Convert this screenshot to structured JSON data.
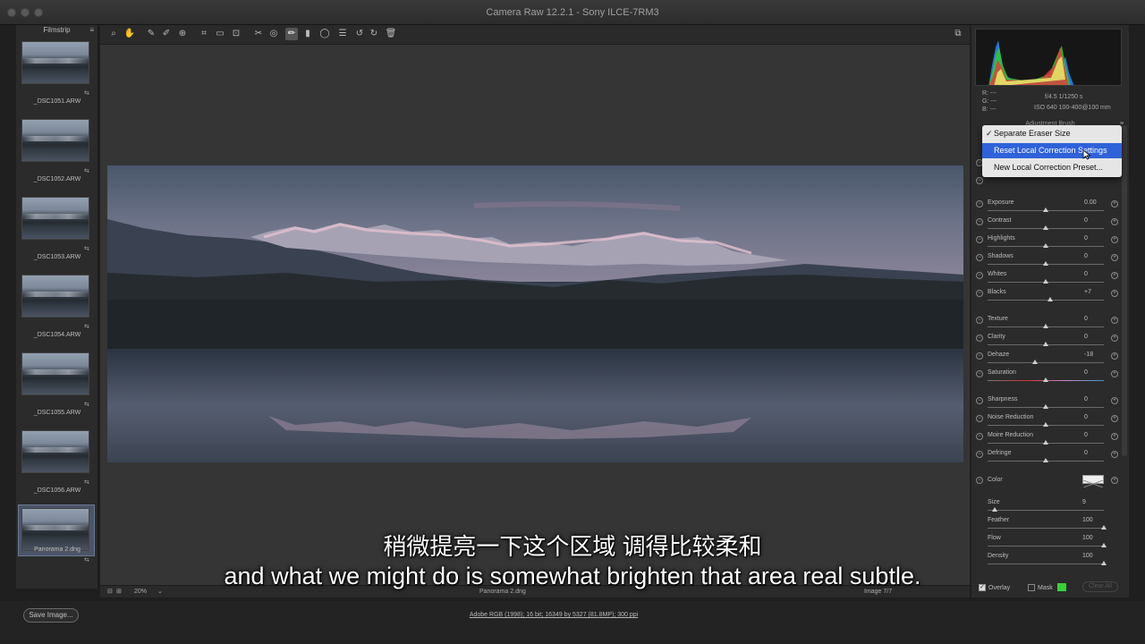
{
  "window": {
    "title": "Camera Raw 12.2.1  -  Sony ILCE-7RM3"
  },
  "filmstrip": {
    "header": "Filmstrip",
    "items": [
      {
        "label": "_DSC1051.ARW"
      },
      {
        "label": "_DSC1052.ARW"
      },
      {
        "label": "_DSC1053.ARW"
      },
      {
        "label": "_DSC1054.ARW"
      },
      {
        "label": "_DSC1055.ARW"
      },
      {
        "label": "_DSC1056.ARW"
      },
      {
        "label": "Panorama 2.dng",
        "selected": true
      }
    ]
  },
  "toolbar": {
    "icons": [
      "zoom-icon",
      "hand-icon",
      "white-balance-icon",
      "color-sampler-icon",
      "targeted-adjustment-icon",
      "crop-icon",
      "straighten-icon",
      "transform-icon",
      "spot-removal-icon",
      "red-eye-icon",
      "adjustment-brush-icon",
      "graduated-filter-icon",
      "radial-filter-icon",
      "preferences-icon",
      "rotate-left-icon",
      "rotate-right-icon",
      "trash-icon"
    ],
    "active": "adjustment-brush-icon"
  },
  "canvas": {
    "zoom": "20%",
    "filename": "Panorama 2.dng",
    "image_count": "Image 7/7"
  },
  "info": {
    "r": "R:  ---",
    "g": "G:  ---",
    "b": "B:  ---",
    "aperture_shutter": "f/4.5   1/1250 s",
    "iso_lens": "ISO 640   100-400@100 mm"
  },
  "panel": {
    "title": "Adjustment Brush"
  },
  "menu": {
    "items": [
      {
        "label": "Separate Eraser Size",
        "checked": true
      },
      {
        "label": "Reset Local Correction Settings",
        "highlighted": true
      },
      {
        "label": "New Local Correction Preset..."
      }
    ]
  },
  "adjustments": [
    {
      "label": "Exposure",
      "value": "0.00",
      "pos": 0.5
    },
    {
      "label": "Contrast",
      "value": "0",
      "pos": 0.5
    },
    {
      "label": "Highlights",
      "value": "0",
      "pos": 0.5
    },
    {
      "label": "Shadows",
      "value": "0",
      "pos": 0.5
    },
    {
      "label": "Whites",
      "value": "0",
      "pos": 0.5
    },
    {
      "label": "Blacks",
      "value": "+7",
      "pos": 0.54
    },
    {
      "label": "Texture",
      "value": "0",
      "pos": 0.5
    },
    {
      "label": "Clarity",
      "value": "0",
      "pos": 0.5
    },
    {
      "label": "Dehaze",
      "value": "-18",
      "pos": 0.41
    },
    {
      "label": "Saturation",
      "value": "0",
      "pos": 0.5
    },
    {
      "label": "Sharpness",
      "value": "0",
      "pos": 0.5
    },
    {
      "label": "Noise Reduction",
      "value": "0",
      "pos": 0.5
    },
    {
      "label": "Moire Reduction",
      "value": "0",
      "pos": 0.5
    },
    {
      "label": "Defringe",
      "value": "0",
      "pos": 0.5
    }
  ],
  "brush": {
    "color_label": "Color",
    "size_label": "Size",
    "size_value": "9",
    "size_pos": 0.06,
    "feather_label": "Feather",
    "feather_value": "100",
    "feather_pos": 1.0,
    "flow_label": "Flow",
    "flow_value": "100",
    "flow_pos": 1.0,
    "density_label": "Density",
    "density_value": "100",
    "density_pos": 1.0
  },
  "overlay": {
    "overlay_label": "Overlay",
    "mask_label": "Mask",
    "clear_all_label": "Clear All",
    "mask_color": "#39d13a"
  },
  "footer": {
    "save_label": "Save Image...",
    "workflow_link": "Adobe RGB (1998); 16 bit; 16349 by 5327 (81.8MP); 300 ppi"
  },
  "subtitles": {
    "zh": "稍微提亮一下这个区域 调得比较柔和",
    "en": "and what we might do is somewhat brighten that area real subtle."
  }
}
